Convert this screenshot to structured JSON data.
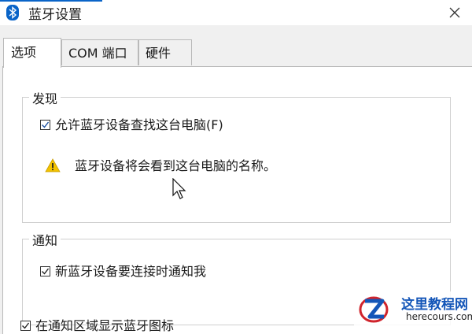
{
  "window": {
    "title": "蓝牙设置",
    "close_icon": "close-icon"
  },
  "tabs": [
    {
      "label": "选项",
      "active": true
    },
    {
      "label": "COM 端口",
      "active": false
    },
    {
      "label": "硬件",
      "active": false
    }
  ],
  "discovery": {
    "title": "发现",
    "allow_label": "允许蓝牙设备查找这台电脑(F)",
    "allow_checked": true,
    "warning_text": "蓝牙设备将会看到这台电脑的名称。"
  },
  "notifications": {
    "title": "通知",
    "notify_label": "新蓝牙设备要连接时通知我",
    "notify_checked": true
  },
  "tray": {
    "label": "在通知区域显示蓝牙图标",
    "checked": true
  },
  "watermark": {
    "title": "这里教程网",
    "url": "herecours.com"
  },
  "colors": {
    "accent": "#0a64c8",
    "warning": "#f2c200",
    "watermark_title": "#1456b8"
  }
}
